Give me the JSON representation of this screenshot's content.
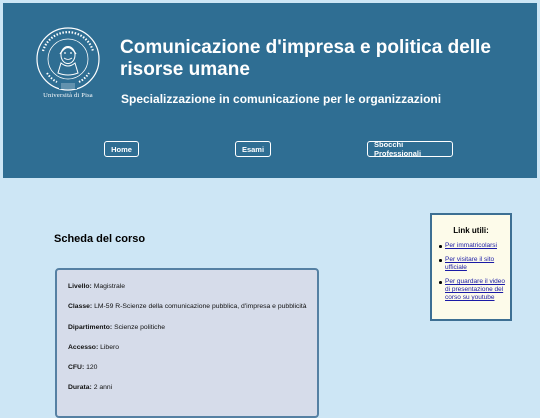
{
  "header": {
    "logo_caption": "Università di Pisa",
    "title": "Comunicazione d'impresa e politica delle risorse umane",
    "subtitle": "Specializzazione in comunicazione per le organizzazioni"
  },
  "nav": {
    "home": "Home",
    "exams": "Esami",
    "careers": "Sbocchi Professionali"
  },
  "main": {
    "section_title": "Scheda del corso",
    "fields": [
      {
        "label": "Livello:",
        "value": "Magistrale"
      },
      {
        "label": "Classe:",
        "value": "LM-59 R-Scienze della comunicazione pubblica, d'impresa e pubblicità"
      },
      {
        "label": "Dipartimento:",
        "value": "Scienze politiche"
      },
      {
        "label": "Accesso:",
        "value": "Libero"
      },
      {
        "label": "CFU:",
        "value": "120"
      },
      {
        "label": "Durata:",
        "value": "2 anni"
      }
    ]
  },
  "sidebar": {
    "title": "Link utili:",
    "links": [
      "Per immatricolarsi",
      "Per visitare il sito ufficiale",
      "Per guardare il video di presentazione del corso su youtube"
    ]
  },
  "colors": {
    "header_bg": "#2f6e93",
    "page_bg": "#cde6f5",
    "card_bg": "#d6dcea",
    "sidebar_bg": "#fdfbea",
    "link": "#1a1aa6"
  }
}
